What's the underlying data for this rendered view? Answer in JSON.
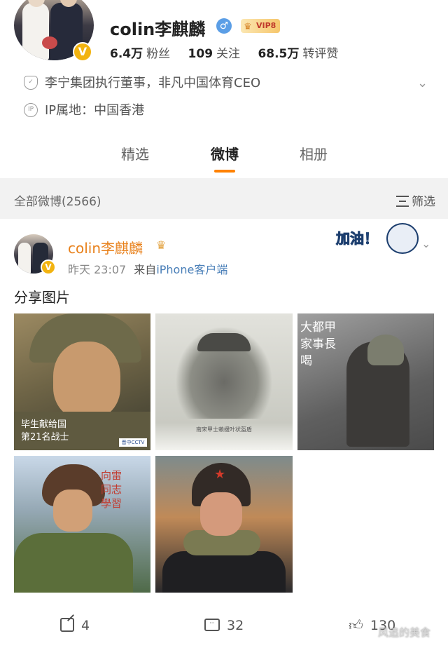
{
  "profile": {
    "username": "colin李麒麟",
    "vip_label": "VIP8",
    "stats": [
      {
        "num": "6.4万",
        "label": "粉丝"
      },
      {
        "num": "109",
        "label": "关注"
      },
      {
        "num": "68.5万",
        "label": "转评赞"
      }
    ],
    "bio": "李宁集团执行董事，非凡中国体育CEO",
    "ip_icon": "IP",
    "ip_location": "IP属地：中国香港"
  },
  "tabs": [
    "精选",
    "微博",
    "相册"
  ],
  "active_tab": "微博",
  "filter": {
    "count_label": "全部微博(2566)",
    "filter_label": "筛选"
  },
  "post": {
    "author": "colin李麒麟",
    "time": "昨天 23:07",
    "source_prefix": "来自",
    "device": "iPhone客户端",
    "text": "分享图片",
    "sticker_text": "加油！",
    "images": [
      {
        "overlay": "毕生献给国\n第21名战士",
        "badge": "晋中CCTV"
      },
      {
        "caption": "南宋甲士赖缓叶状盔盾"
      },
      {
        "overlay": "大都甲\n家事長\n喝"
      },
      {
        "overlay": "向雷\n同志\n學習"
      },
      {}
    ],
    "actions": {
      "share": "4",
      "comment": "32",
      "like": "130"
    }
  },
  "watermark": "风追的美食",
  "icons": {
    "verified": "verified-v-icon",
    "gender": "male-icon",
    "vip": "crown-icon",
    "bio": "shield-icon",
    "ip": "ip-icon",
    "expand": "chevron-down-icon",
    "filter": "filter-icon",
    "share": "share-icon",
    "comment": "comment-icon",
    "like": "thumbs-up-icon"
  },
  "colors": {
    "accent": "#ff8200",
    "name_orange": "#e8801a",
    "verify_gold": "#f2b310",
    "link_blue": "#4a7fb8"
  }
}
